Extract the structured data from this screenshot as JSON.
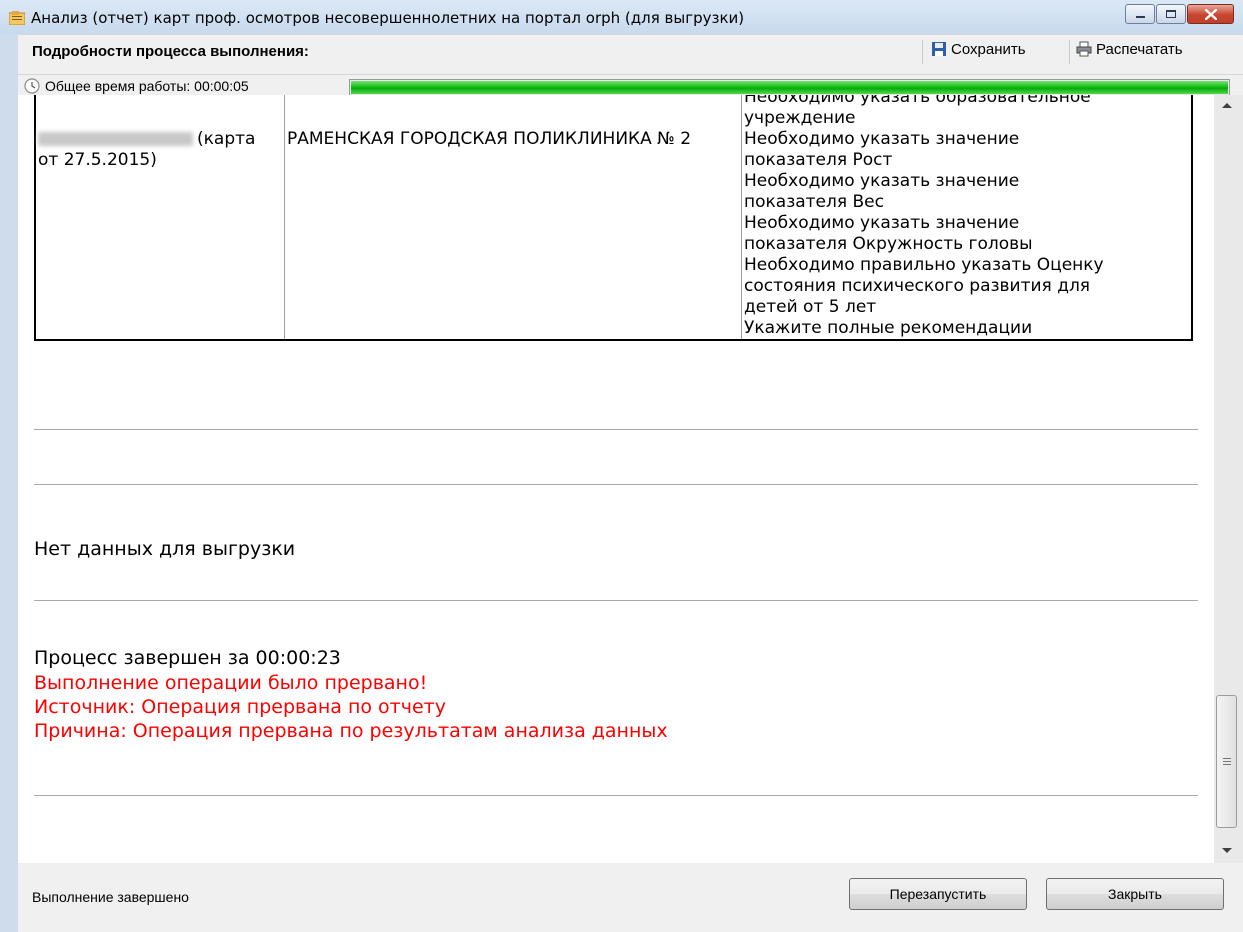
{
  "window": {
    "title": "Анализ (отчет) карт проф. осмотров несовершеннолетних на портал orph (для выгрузки)"
  },
  "toolbar": {
    "details_label": "Подробности процесса выполнения:",
    "save_label": "Сохранить",
    "print_label": "Распечатать"
  },
  "progress": {
    "time_label": "Общее время работы: 00:00:05",
    "percent": 100,
    "color": "#11c311"
  },
  "report": {
    "row": {
      "patient_suffix": "(карта",
      "patient_date": "от 27.5.2015)",
      "organization": "РАМЕНСКАЯ ГОРОДСКАЯ ПОЛИКЛИНИКА № 2",
      "errors": [
        "Необходимо указать образовательное",
        "учреждение",
        "Необходимо указать значение",
        "показателя Рост",
        "Необходимо указать значение",
        "показателя Вес",
        "Необходимо указать значение",
        "показателя Окружность головы",
        "Необходимо правильно указать Оценку",
        "состояния психического развития для",
        "детей от 5 лет",
        "Укажите полные рекомендации"
      ]
    },
    "no_data": "Нет данных для выгрузки",
    "process_done": "Процесс завершен за 00:00:23",
    "interrupted": "Выполнение операции было прервано!",
    "source": "Источник: Операция прервана по отчету",
    "reason": "Причина: Операция прервана по результатам анализа данных",
    "error_color": "#ff0000"
  },
  "status": {
    "text": "Выполнение завершено",
    "restart_label": "Перезапустить",
    "close_label": "Закрыть"
  }
}
